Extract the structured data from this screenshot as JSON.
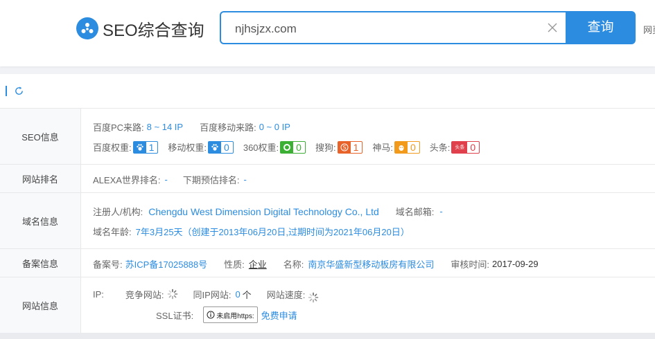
{
  "header": {
    "logo_text": "SEO综合查询",
    "search_value": "njhsjzx.com",
    "search_button": "查询",
    "cut_text": "网页"
  },
  "rows": {
    "seo": {
      "label": "SEO信息",
      "baidu_pc_label": "百度PC来路:",
      "baidu_pc_value": "8 ~ 14 IP",
      "baidu_mobile_label": "百度移动来路:",
      "baidu_mobile_value": "0 ~ 0 IP",
      "weights": [
        {
          "label": "百度权重:",
          "value": "1",
          "icon": "paw-icon",
          "color": "#2b8ce0"
        },
        {
          "label": "移动权重:",
          "value": "0",
          "icon": "paw-icon",
          "color": "#2b8ce0"
        },
        {
          "label": "360权重:",
          "value": "0",
          "icon": "360-icon",
          "color": "#3cb035"
        },
        {
          "label": "搜狗:",
          "value": "1",
          "icon": "sogou-icon",
          "color": "#e8632a"
        },
        {
          "label": "神马:",
          "value": "0",
          "icon": "shenma-icon",
          "color": "#f19a1c"
        },
        {
          "label": "头条:",
          "value": "0",
          "icon": "toutiao-icon",
          "color": "#e0404b"
        }
      ],
      "toutiao_icon_text": "头条"
    },
    "rank": {
      "label": "网站排名",
      "alexa_label": "ALEXA世界排名:",
      "alexa_value": "-",
      "next_label": "下期预估排名:",
      "next_value": "-"
    },
    "domain": {
      "label": "域名信息",
      "registrant_label": "注册人/机构:",
      "registrant_value": "Chengdu West Dimension Digital Technology Co., Ltd",
      "email_label": "域名邮箱:",
      "email_value": "-",
      "age_label": "域名年龄:",
      "age_value": "7年3月25天（创建于2013年06月20日,过期时间为2021年06月20日）"
    },
    "icp": {
      "label": "备案信息",
      "no_label": "备案号:",
      "no_value": "苏ICP备17025888号",
      "nature_label": "性质:",
      "nature_value": "企业",
      "name_label": "名称:",
      "name_value": "南京华盛新型移动板房有限公司",
      "audit_label": "审核时间:",
      "audit_value": "2017-09-29"
    },
    "site": {
      "label": "网站信息",
      "ip_label": "IP:",
      "compete_label": "竞争网站:",
      "sameip_label": "同IP网站:",
      "sameip_value": "0",
      "sameip_unit": "个",
      "speed_label": "网站速度:",
      "ssl_label": "SSL证书:",
      "ssl_button": "未启用https:",
      "ssl_link": "免费申请"
    }
  },
  "colors": {
    "accent": "#2b8ce0"
  }
}
